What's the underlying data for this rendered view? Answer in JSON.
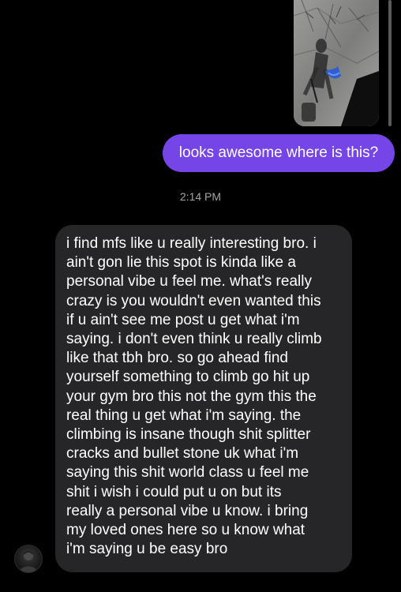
{
  "thread": {
    "sent_message": "looks awesome where is this?",
    "timestamp": "2:14 PM",
    "received_message_lines": [
      "i find mfs like u really interesting bro. i",
      "ain't gon lie this spot is kinda like a",
      "personal vibe u feel me. what's really",
      "crazy is you wouldn't even wanted this",
      "if u ain't see me post u get what i'm",
      "saying. i don't even think u really climb",
      "like that tbh bro. so go ahead find",
      "yourself something to climb go hit up",
      "your gym bro this not the gym this the",
      "real thing u get what i'm saying. the",
      "climbing is insane though shit splitter",
      "cracks and bullet stone uk what i'm",
      "saying this shit world class u feel me",
      "shit i wish i could put u on but its",
      "really a personal vibe u know. i bring",
      "my loved ones here so u know what",
      "i'm saying u be easy bro"
    ]
  },
  "colors": {
    "background": "#000000",
    "sent_bubble": "#7645e8",
    "received_bubble": "#262628",
    "timestamp_text": "#a4a4a8"
  },
  "icons": {
    "avatar": "avatar",
    "shared_photo": "shared-photo"
  }
}
